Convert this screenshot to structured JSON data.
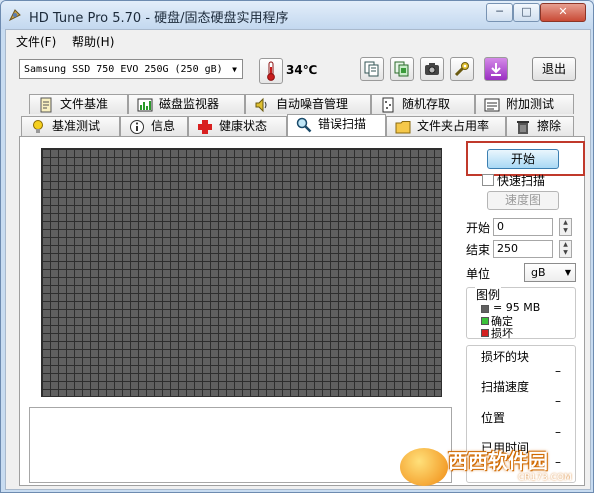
{
  "window": {
    "title": "HD Tune Pro 5.70 - 硬盘/固态硬盘实用程序",
    "minimize": "─",
    "restore": "□",
    "close": "✕"
  },
  "menu": {
    "file": "文件(F)",
    "help": "帮助(H)"
  },
  "toolbar": {
    "drive": "Samsung SSD 750 EVO 250G (250 gB)",
    "temperature": "34℃",
    "exit_label": "退出",
    "icons": [
      "copy-text-icon",
      "copy-screenshot-icon",
      "camera-icon",
      "settings-icon",
      "save-icon"
    ]
  },
  "tabs": {
    "row1": [
      "文件基准",
      "磁盘监视器",
      "自动噪音管理",
      "随机存取",
      "附加测试"
    ],
    "row2": [
      "基准测试",
      "信息",
      "健康状态",
      "错误扫描",
      "文件夹占用率",
      "擦除"
    ],
    "active": "错误扫描"
  },
  "scan": {
    "start_label": "开始",
    "quick_scan_label": "快速扫描",
    "quick_scan_checked": false,
    "graph_label": "速度图",
    "start_field_label": "开始",
    "start_value": "0",
    "end_field_label": "结束",
    "end_value": "250",
    "unit_label": "单位",
    "unit_value": "gB",
    "legend_title": "图例",
    "legend_block": "= 95 MB",
    "legend_ok": "确定",
    "legend_bad": "损坏",
    "stat_damaged": "损坏的块",
    "stat_speed": "扫描速度",
    "stat_position": "位置",
    "stat_elapsed": "已用时间",
    "stat_damaged_value": "–",
    "stat_speed_value": "–",
    "stat_position_value": "–",
    "stat_elapsed_value": "–"
  },
  "colors": {
    "block_gray": "#606060",
    "block_ok": "#3ac23a",
    "block_bad": "#d42020",
    "highlight": "#c0392b"
  },
  "watermark": {
    "text": "西西软件园",
    "url": "CR173.COM"
  }
}
